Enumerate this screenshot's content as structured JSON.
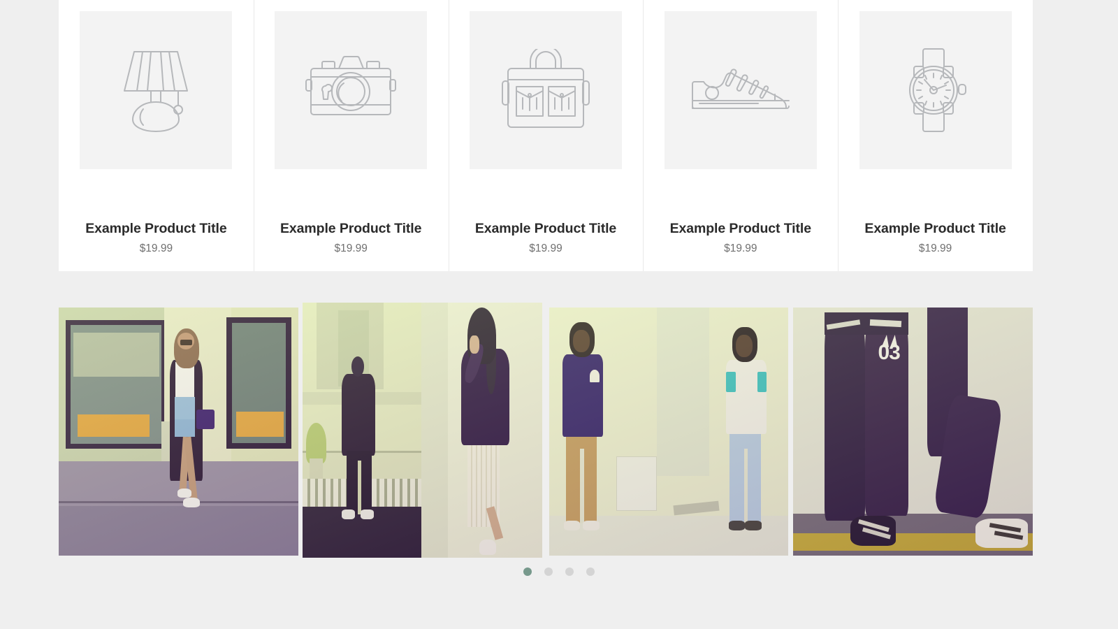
{
  "theme": {
    "page_background": "#efefef",
    "card_background": "#ffffff",
    "thumb_background": "#f3f3f3",
    "title_color": "#2b2b2b",
    "price_color": "#707070",
    "divider_color": "#e9e9e9",
    "dot_inactive_color": "#d4d4d4",
    "dot_active_color": "#77998c"
  },
  "product_row": {
    "products": [
      {
        "icon": "table-lamp-icon",
        "title": "Example Product Title",
        "price": "$19.99"
      },
      {
        "icon": "camera-icon",
        "title": "Example Product Title",
        "price": "$19.99"
      },
      {
        "icon": "handbag-icon",
        "title": "Example Product Title",
        "price": "$19.99"
      },
      {
        "icon": "sneaker-icon",
        "title": "Example Product Title",
        "price": "$19.99"
      },
      {
        "icon": "wristwatch-icon",
        "title": "Example Product Title",
        "price": "$19.99"
      }
    ]
  },
  "gallery": {
    "images": [
      {
        "name": "woman-in-black-coat-on-street",
        "alt": "Woman wearing black long coat, white top and denim skirt standing on a city sidewalk"
      },
      {
        "name": "man-on-rooftop",
        "alt": "Man in dark hoodie and joggers standing on a rooftop ledge"
      },
      {
        "name": "woman-in-white-pleated-skirt",
        "alt": "Woman with dark hair in oversized jacket and white pleated skirt"
      },
      {
        "name": "two-men-in-studio",
        "alt": "Two men with dreadlocks standing in a bright studio"
      },
      {
        "name": "legs-in-track-pants",
        "alt": "Close-up of legs in dark track pants with 03 print and white sneakers"
      }
    ]
  },
  "carousel": {
    "dots": [
      {
        "label": "1",
        "active": true
      },
      {
        "label": "2",
        "active": false
      },
      {
        "label": "3",
        "active": false
      },
      {
        "label": "4",
        "active": false
      }
    ]
  }
}
